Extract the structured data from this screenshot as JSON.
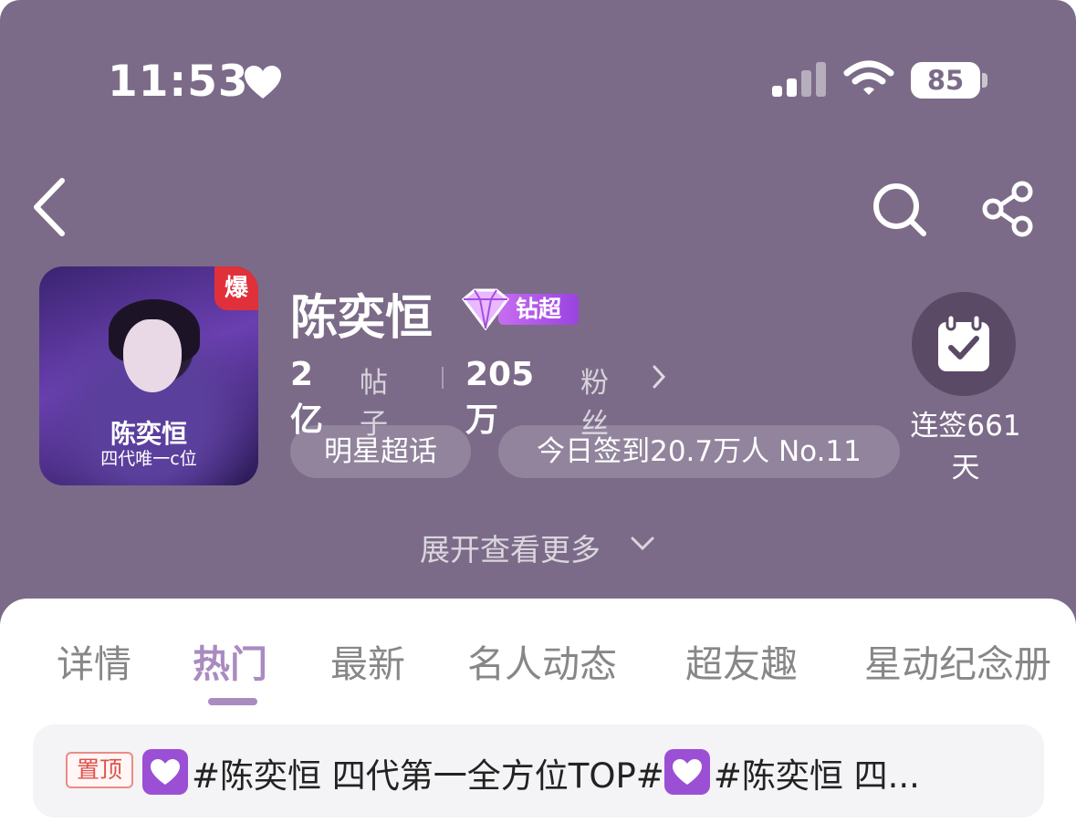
{
  "status_bar": {
    "time": "11:53",
    "battery": "85"
  },
  "profile": {
    "name": "陈奕恒",
    "tier_label": "钻超",
    "hot_badge": "爆",
    "avatar_caption_name": "陈奕恒",
    "avatar_caption_sub": "四代唯一c位",
    "posts_count": "2亿",
    "posts_label": "帖子",
    "fans_count": "205万",
    "fans_label": "粉丝",
    "tags": [
      "明星超话",
      "今日签到20.7万人 No.11"
    ],
    "checkin_label": "连签661天",
    "expand_label": "展开查看更多"
  },
  "tabs": [
    {
      "label": "详情",
      "active": false
    },
    {
      "label": "热门",
      "active": true
    },
    {
      "label": "最新",
      "active": false
    },
    {
      "label": "名人动态",
      "active": false
    },
    {
      "label": "超友趣",
      "active": false
    },
    {
      "label": "星动纪念册",
      "active": false
    }
  ],
  "pinned_post": {
    "tag": "置顶",
    "text_1": "#陈奕恒 四代第一全方位TOP#",
    "text_2": "#陈奕恒 四..."
  },
  "colors": {
    "header_bg": "#7b6b88",
    "accent": "#a98bc1",
    "tier": "#b35ce8",
    "hot": "#e0303a"
  }
}
